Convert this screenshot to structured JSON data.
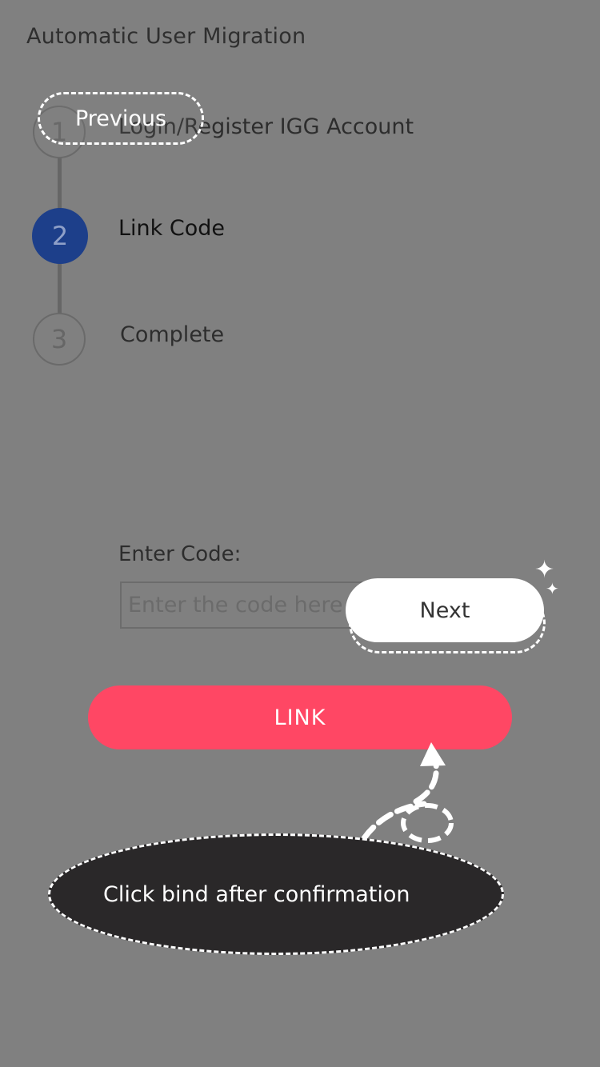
{
  "header": {
    "title": "Automatic User Migration"
  },
  "steps": [
    {
      "number": "1",
      "label": "Login/Register IGG Account"
    },
    {
      "number": "2",
      "label": "Link Code"
    },
    {
      "number": "3",
      "label": "Complete"
    }
  ],
  "tutorial": {
    "previous_label": "Previous",
    "next_label": "Next",
    "tip_text": "Click bind after confirmation"
  },
  "form": {
    "code_label": "Enter Code:",
    "code_placeholder": "Enter the code here",
    "link_label": "LINK"
  },
  "colors": {
    "background": "#808080",
    "active_step": "#1d3f8a",
    "link_button": "#ff4764",
    "tooltip": "#2a2829"
  }
}
